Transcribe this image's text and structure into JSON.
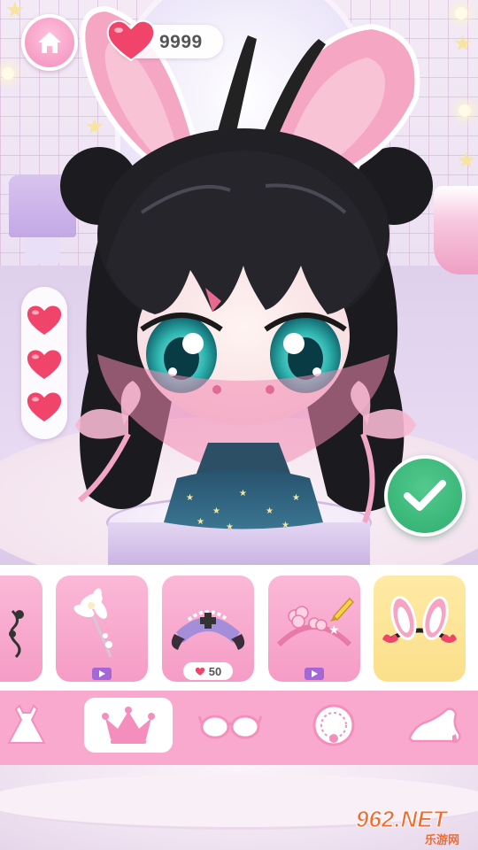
{
  "hud": {
    "home_icon": "home-icon",
    "coins_icon": "heart-icon",
    "coins_value": "9999",
    "lives": 3,
    "life_icon": "heart-icon",
    "confirm_icon": "checkmark-icon"
  },
  "items": [
    {
      "name": "hair-clip",
      "icon": "clip-icon",
      "badge": "none"
    },
    {
      "name": "feather-hairpin",
      "icon": "feather-icon",
      "badge": "video"
    },
    {
      "name": "nurse-horn-headband",
      "icon": "headband-icon",
      "badge": "price",
      "price": "50"
    },
    {
      "name": "flower-headband",
      "icon": "flower-headband-icon",
      "badge": "video"
    },
    {
      "name": "bunny-ears-headband",
      "icon": "bunny-ears-icon",
      "badge": "none",
      "selected": true
    }
  ],
  "categories": [
    {
      "name": "dress",
      "icon": "dress-icon"
    },
    {
      "name": "headwear",
      "icon": "crown-icon",
      "active": true
    },
    {
      "name": "glasses",
      "icon": "glasses-icon"
    },
    {
      "name": "necklace",
      "icon": "necklace-icon"
    },
    {
      "name": "shoes",
      "icon": "shoe-icon"
    }
  ],
  "colors": {
    "primary_pink": "#f59cc6",
    "category_bar": "#f9a9cd",
    "confirm_green": "#2fae6f",
    "selected_item": "#fbdf8a",
    "heart_red": "#f0446a"
  },
  "watermark": {
    "main": "962.NET",
    "sub": "乐游网"
  }
}
